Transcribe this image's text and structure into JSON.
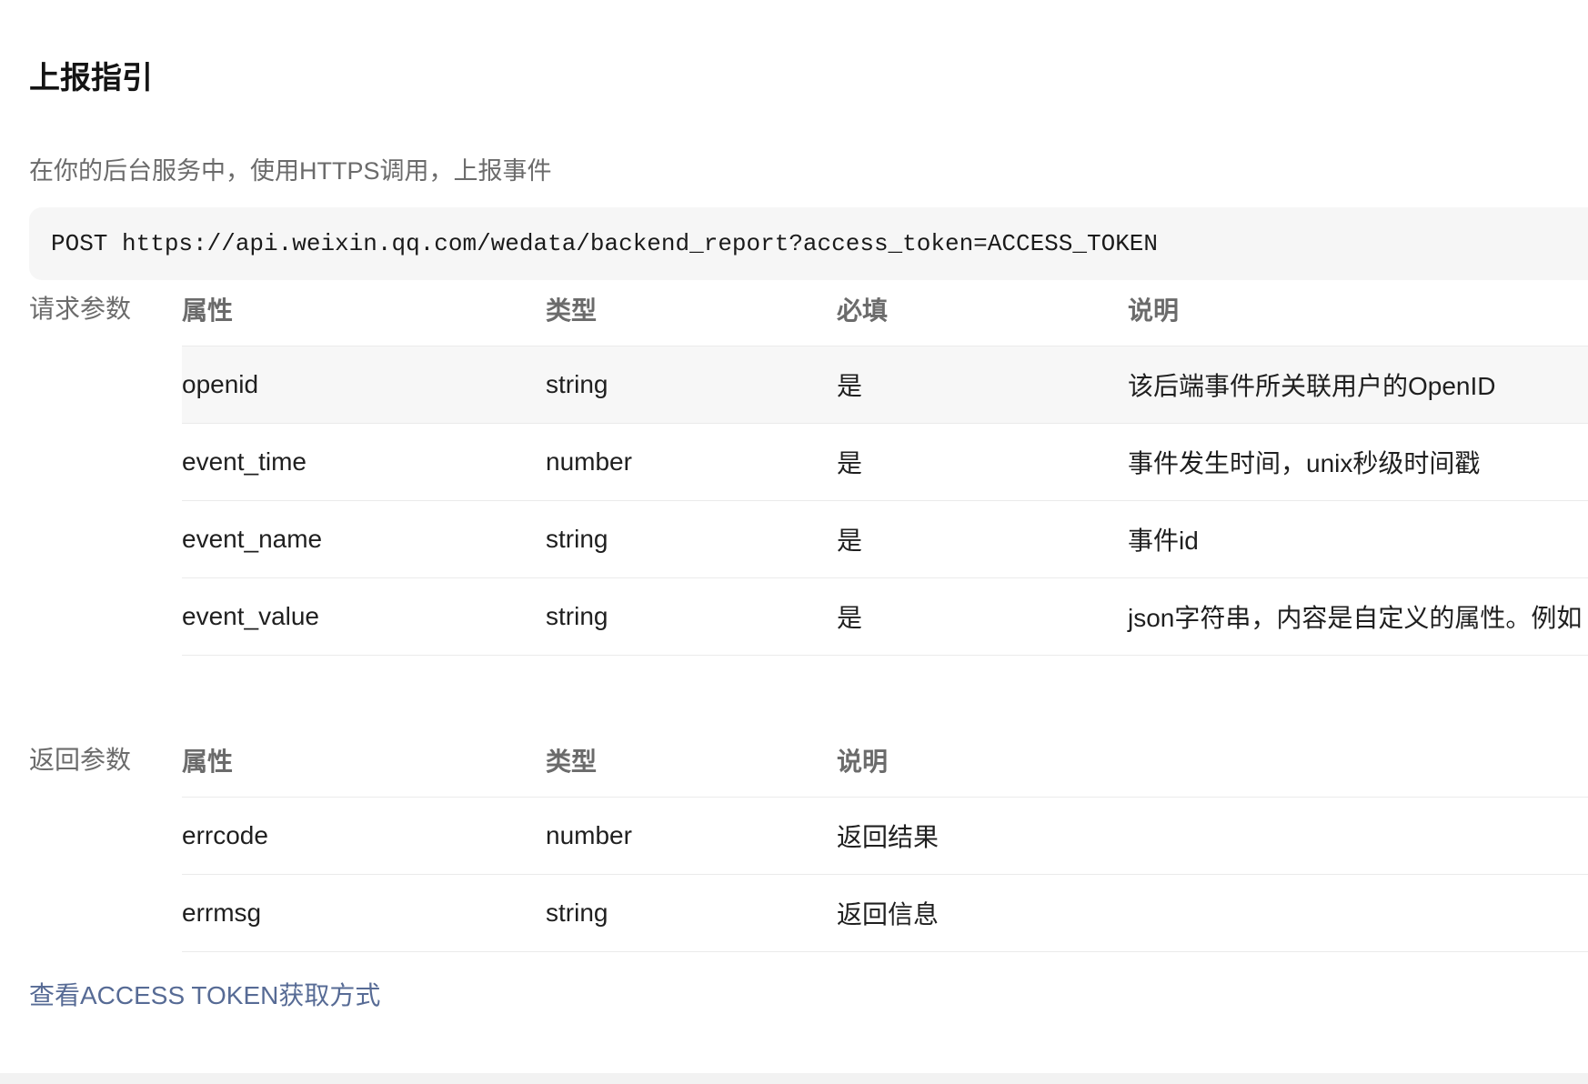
{
  "title": "上报指引",
  "description": "在你的后台服务中，使用HTTPS调用，上报事件",
  "code": "POST https://api.weixin.qq.com/wedata/backend_report?access_token=ACCESS_TOKEN",
  "request_params": {
    "label": "请求参数",
    "headers": [
      "属性",
      "类型",
      "必填",
      "说明"
    ],
    "rows": [
      {
        "name": "openid",
        "type": "string",
        "required": "是",
        "desc": "该后端事件所关联用户的OpenID"
      },
      {
        "name": "event_time",
        "type": "number",
        "required": "是",
        "desc": "事件发生时间，unix秒级时间戳"
      },
      {
        "name": "event_name",
        "type": "string",
        "required": "是",
        "desc": "事件id"
      },
      {
        "name": "event_value",
        "type": "string",
        "required": "是",
        "desc": "json字符串，内容是自定义的属性。例如"
      }
    ]
  },
  "response_params": {
    "label": "返回参数",
    "headers": [
      "属性",
      "类型",
      "说明"
    ],
    "rows": [
      {
        "name": "errcode",
        "type": "number",
        "desc": "返回结果"
      },
      {
        "name": "errmsg",
        "type": "string",
        "desc": "返回信息"
      }
    ]
  },
  "link": "查看ACCESS TOKEN获取方式"
}
